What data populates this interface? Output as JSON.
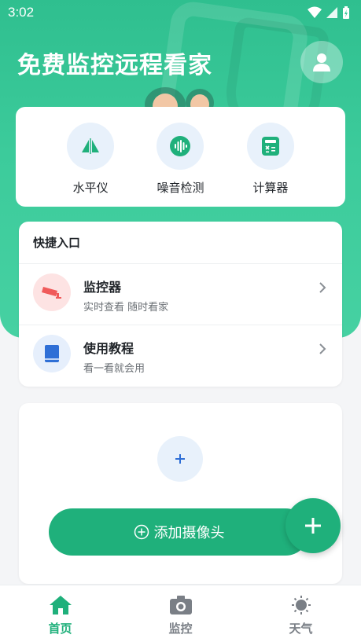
{
  "status_bar": {
    "time": "3:02",
    "wifi_icon": "wifi-icon",
    "signal_icon": "signal-icon",
    "battery_icon": "battery-icon"
  },
  "header": {
    "title": "免费监控远程看家",
    "avatar_icon": "user-icon"
  },
  "tools": [
    {
      "label": "水平仪",
      "icon": "level-icon"
    },
    {
      "label": "噪音检测",
      "icon": "sound-wave-icon"
    },
    {
      "label": "计算器",
      "icon": "calculator-icon"
    }
  ],
  "quick_entry": {
    "title": "快捷入口",
    "items": [
      {
        "title": "监控器",
        "subtitle": "实时查看 随时看家",
        "icon": "camera-icon"
      },
      {
        "title": "使用教程",
        "subtitle": "看一看就会用",
        "icon": "book-icon"
      }
    ]
  },
  "camera_card": {
    "add_button_label": "添加摄像头",
    "plus_icon": "plus-icon"
  },
  "fab": {
    "icon": "plus-icon"
  },
  "bottom_nav": [
    {
      "label": "首页",
      "icon": "home-icon",
      "active": true
    },
    {
      "label": "监控",
      "icon": "camera-icon",
      "active": false
    },
    {
      "label": "天气",
      "icon": "sun-icon",
      "active": false
    }
  ],
  "colors": {
    "primary": "#1fb07b",
    "hero": "#3ccb9b",
    "accent_blue": "#2f6fd6",
    "inactive": "#7a7f86",
    "red_icon": "#f05a5a"
  }
}
